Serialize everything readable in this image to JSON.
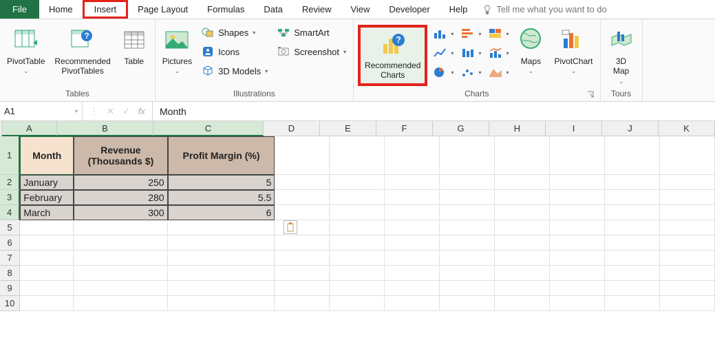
{
  "menubar": {
    "file": "File",
    "tabs": [
      "Home",
      "Insert",
      "Page Layout",
      "Formulas",
      "Data",
      "Review",
      "View",
      "Developer",
      "Help"
    ],
    "active_tab": "Insert",
    "tell_me_placeholder": "Tell me what you want to do"
  },
  "ribbon": {
    "tables": {
      "label": "Tables",
      "pivottable": "PivotTable",
      "recommended_pivot": "Recommended\nPivotTables",
      "table": "Table"
    },
    "illustrations": {
      "label": "Illustrations",
      "pictures": "Pictures",
      "shapes": "Shapes",
      "icons": "Icons",
      "models3d": "3D Models",
      "smartart": "SmartArt",
      "screenshot": "Screenshot"
    },
    "charts": {
      "label": "Charts",
      "recommended_charts": "Recommended\nCharts",
      "maps": "Maps",
      "pivotchart": "PivotChart"
    },
    "tours": {
      "label": "Tours",
      "map3d": "3D\nMap"
    }
  },
  "formula_bar": {
    "namebox": "A1",
    "formula": "Month"
  },
  "grid": {
    "columns": [
      "A",
      "B",
      "C",
      "D",
      "E",
      "F",
      "G",
      "H",
      "I",
      "J",
      "K"
    ],
    "selected_cols": [
      "A",
      "B",
      "C"
    ],
    "selected_rows": [
      1,
      2,
      3,
      4
    ],
    "row_count": 10,
    "headers": [
      "Month",
      "Revenue (Thousands $)",
      "Profit Margin (%)"
    ],
    "data": [
      {
        "month": "January",
        "revenue": "250",
        "margin": "5"
      },
      {
        "month": "February",
        "revenue": "280",
        "margin": "5.5"
      },
      {
        "month": "March",
        "revenue": "300",
        "margin": "6"
      }
    ]
  }
}
